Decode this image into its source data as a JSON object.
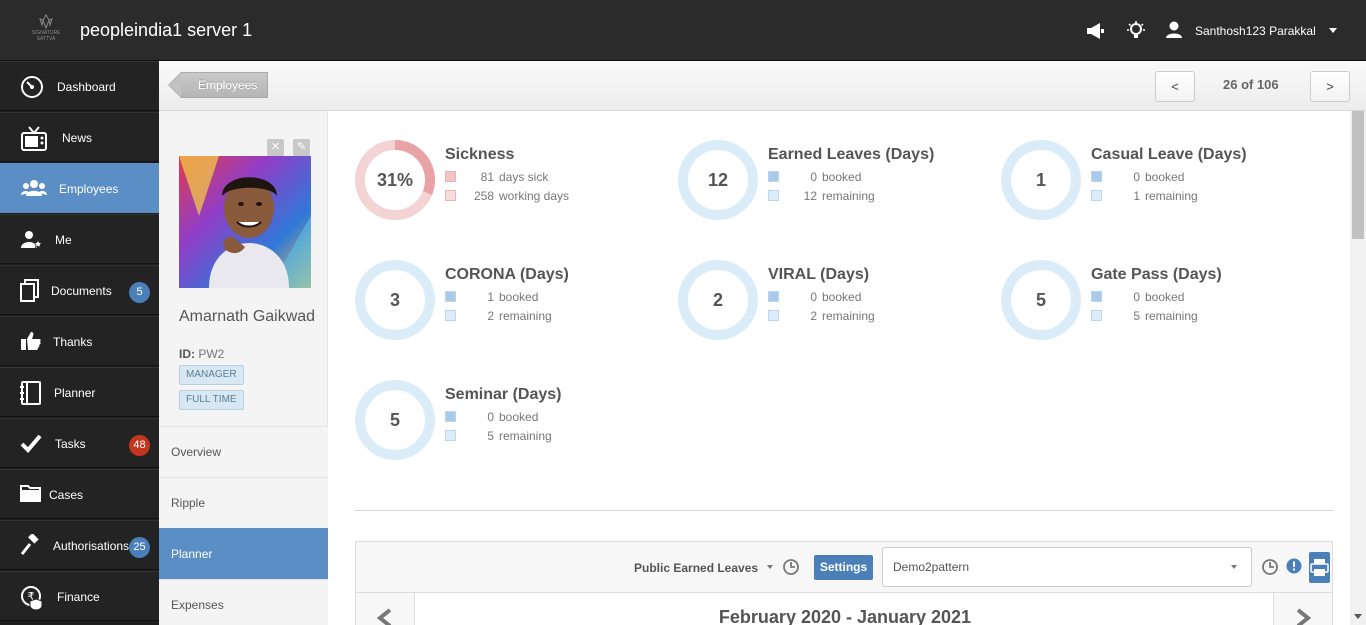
{
  "app": {
    "logo_text": "SIGNATURE SATTVA",
    "title": "peopleindia1 server 1",
    "top_icons": [
      "megaphone-icon",
      "lightbulb-icon",
      "user-icon"
    ],
    "user_name": "Santhosh123 Parakkal"
  },
  "sidebar": {
    "items": [
      {
        "label": "Dashboard",
        "icon": "dashboard-icon"
      },
      {
        "label": "News",
        "icon": "tv-icon"
      },
      {
        "label": "Employees",
        "icon": "people-icon",
        "active": true
      },
      {
        "label": "Me",
        "icon": "user-star-icon"
      },
      {
        "label": "Documents",
        "icon": "document-icon",
        "badge": "5"
      },
      {
        "label": "Thanks",
        "icon": "thumbs-up-icon"
      },
      {
        "label": "Planner",
        "icon": "planner-icon"
      },
      {
        "label": "Tasks",
        "icon": "check-icon",
        "badge": "48"
      },
      {
        "label": "Cases",
        "icon": "folder-icon"
      },
      {
        "label": "Authorisations",
        "icon": "gavel-icon",
        "badge": "25"
      },
      {
        "label": "Finance",
        "icon": "rupee-icon"
      }
    ]
  },
  "header": {
    "breadcrumb": "Employees",
    "prev": "<",
    "next": ">",
    "pager": "26 of 106"
  },
  "profile": {
    "name": "Amarnath Gaikwad",
    "id_label": "ID:",
    "id_value": "PW2",
    "tags": [
      "MANAGER",
      "FULL TIME"
    ],
    "tabs": [
      "Overview",
      "Ripple",
      "Planner",
      "Expenses"
    ],
    "active_tab": "Planner"
  },
  "stats": [
    {
      "title": "Sickness",
      "center": "31%",
      "percent": 31,
      "type": "sick",
      "rows": [
        {
          "value": "81",
          "text": "days sick"
        },
        {
          "value": "258",
          "text": "working days"
        }
      ]
    },
    {
      "title": "Earned Leaves (Days)",
      "center": "12",
      "type": "leave",
      "rows": [
        {
          "value": "0",
          "text": "booked"
        },
        {
          "value": "12",
          "text": "remaining"
        }
      ]
    },
    {
      "title": "Casual Leave (Days)",
      "center": "1",
      "type": "leave",
      "rows": [
        {
          "value": "0",
          "text": "booked"
        },
        {
          "value": "1",
          "text": "remaining"
        }
      ]
    },
    {
      "title": "CORONA (Days)",
      "center": "3",
      "type": "leave",
      "rows": [
        {
          "value": "1",
          "text": "booked"
        },
        {
          "value": "2",
          "text": "remaining"
        }
      ]
    },
    {
      "title": "VIRAL (Days)",
      "center": "2",
      "type": "leave",
      "rows": [
        {
          "value": "0",
          "text": "booked"
        },
        {
          "value": "2",
          "text": "remaining"
        }
      ]
    },
    {
      "title": "Gate Pass (Days)",
      "center": "5",
      "type": "leave",
      "rows": [
        {
          "value": "0",
          "text": "booked"
        },
        {
          "value": "5",
          "text": "remaining"
        }
      ]
    },
    {
      "title": "Seminar (Days)",
      "center": "5",
      "type": "leave",
      "rows": [
        {
          "value": "0",
          "text": "booked"
        },
        {
          "value": "5",
          "text": "remaining"
        }
      ]
    }
  ],
  "planner": {
    "filter": "Public Earned Leaves",
    "settings_label": "Settings",
    "pattern": "Demo2pattern",
    "range": "February 2020 - January 2021"
  },
  "colors": {
    "accent": "#5b8ec4",
    "sick_ring": "#f3d3d4",
    "sick_arc": "#e9a3a6",
    "leave_ring": "#daecf7",
    "booked_square": "#a9cbe9",
    "remaining_square": "#dcedf8"
  }
}
